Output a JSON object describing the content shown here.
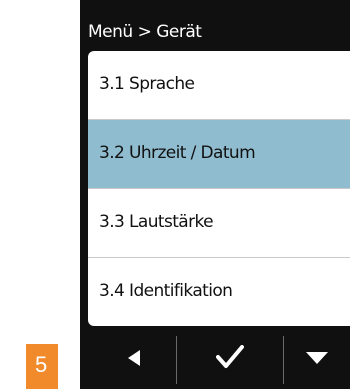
{
  "header": {
    "title": "Menü > Gerät"
  },
  "menu": {
    "items": [
      {
        "label": "3.1 Sprache"
      },
      {
        "label": "3.2 Uhrzeit / Datum"
      },
      {
        "label": "3.3 Lautstärke"
      },
      {
        "label": "3.4 Identifikation"
      }
    ],
    "selected_index": 1,
    "selected_color": "#8fbccf"
  },
  "footer": {
    "buttons": [
      {
        "icon": "triangle-left-icon"
      },
      {
        "icon": "checkmark-icon"
      },
      {
        "icon": "triangle-down-icon"
      }
    ]
  },
  "callout": {
    "number": "5",
    "color": "#f08a2a"
  }
}
